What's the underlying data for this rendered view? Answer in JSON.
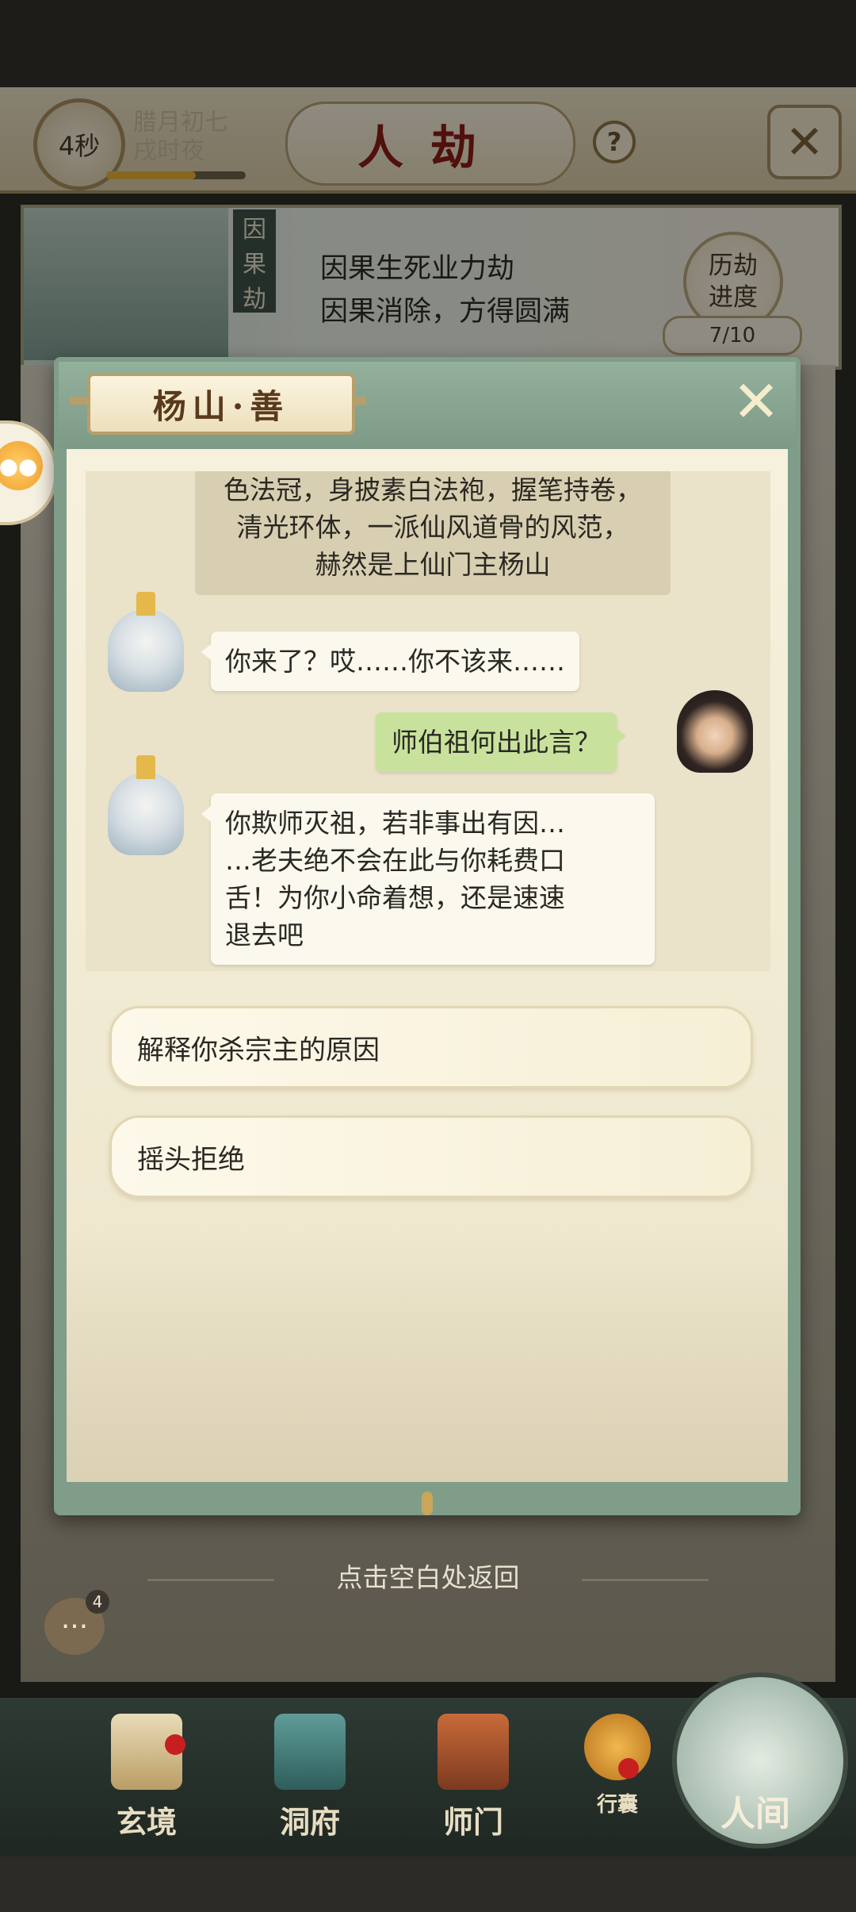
{
  "header": {
    "timer": "4秒",
    "date_line1": "腊月初七",
    "date_line2": "戌时夜",
    "time_progress": 0.64,
    "title": "人劫",
    "help_symbol": "?",
    "close_symbol": "✕"
  },
  "banner": {
    "tag": [
      "因",
      "果",
      "劫"
    ],
    "line1": "因果生死业力劫",
    "line2": "因果消除，方得圆满",
    "progress_label1": "历劫",
    "progress_label2": "进度",
    "progress_value": "7/10"
  },
  "dialog": {
    "speaker": "杨山·善",
    "close_symbol": "✕",
    "narration": [
      "色法冠，身披素白法袍，握笔持卷，",
      "清光环体，一派仙风道骨的风范，",
      "赫然是上仙门主杨山"
    ],
    "messages": [
      {
        "side": "left",
        "speaker": "杨山",
        "text": "你来了？哎……你不该来……"
      },
      {
        "side": "right",
        "speaker": "player",
        "text": "师伯祖何出此言？"
      },
      {
        "side": "left",
        "speaker": "杨山",
        "lines": [
          "你欺师灭祖，若非事出有因…",
          "…老夫绝不会在此与你耗费口",
          "舌！为你小命着想，还是速速",
          "退去吧"
        ]
      }
    ],
    "choices": [
      "解释你杀宗主的原因",
      "摇头拒绝"
    ]
  },
  "hint": "点击空白处返回",
  "chat_badge": "4",
  "nav": {
    "items": [
      {
        "label": "玄境",
        "icon": "scroll-icon",
        "dot": true
      },
      {
        "label": "洞府",
        "icon": "pavilion-icon",
        "dot": false
      },
      {
        "label": "师门",
        "icon": "banner-flag-icon",
        "dot": false
      },
      {
        "label": "行囊",
        "icon": "pouch-icon",
        "dot": true
      },
      {
        "label": "人间",
        "icon": "landscape-icon",
        "dot": false
      }
    ]
  },
  "colors": {
    "title_red": "#8b1d16",
    "dialog_green": "#7f9d89",
    "player_bubble": "#c8e29d",
    "parchment": "#f6f1dd"
  }
}
